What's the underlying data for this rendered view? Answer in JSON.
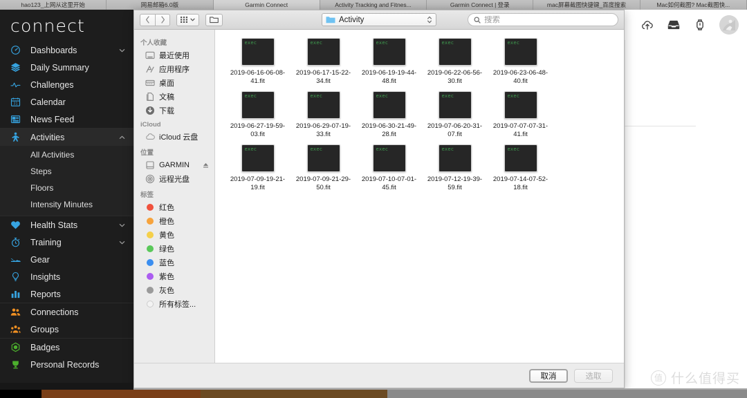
{
  "browser": {
    "tabs": [
      {
        "label": "hao123_上网从这里开始",
        "active": false
      },
      {
        "label": "网易邮箱6.0版",
        "active": false
      },
      {
        "label": "Garmin Connect",
        "active": true
      },
      {
        "label": "Activity Tracking and Fitnes...",
        "active": false
      },
      {
        "label": "Garmin Connect | 登录",
        "active": false
      },
      {
        "label": "mac屏幕截图快捷键_百度搜索",
        "active": false
      },
      {
        "label": "Mac如何截图? Mac截图快...",
        "active": false
      }
    ]
  },
  "garmin": {
    "logo": "connect",
    "header_icons": [
      {
        "name": "cloud-upload-icon"
      },
      {
        "name": "inbox-icon"
      },
      {
        "name": "watch-icon"
      },
      {
        "name": "avatar"
      }
    ],
    "nav_groups": [
      {
        "items": [
          {
            "label": "Dashboards",
            "icon": "gauge-icon",
            "color": "blue",
            "chevron": "down",
            "selected": false
          },
          {
            "label": "Daily Summary",
            "icon": "layers-icon",
            "color": "blue",
            "chevron": "",
            "selected": false
          },
          {
            "label": "Challenges",
            "icon": "pulse-icon",
            "color": "blue",
            "chevron": "",
            "selected": false
          },
          {
            "label": "Calendar",
            "icon": "calendar-icon",
            "color": "blue",
            "chevron": "",
            "selected": false
          },
          {
            "label": "News Feed",
            "icon": "news-icon",
            "color": "blue",
            "chevron": "",
            "selected": false
          }
        ]
      },
      {
        "items": [
          {
            "label": "Activities",
            "icon": "runner-icon",
            "color": "blue",
            "chevron": "up",
            "selected": true
          }
        ],
        "sub_items": [
          {
            "label": "All Activities"
          },
          {
            "label": "Steps"
          },
          {
            "label": "Floors"
          },
          {
            "label": "Intensity Minutes"
          }
        ]
      },
      {
        "items": [
          {
            "label": "Health Stats",
            "icon": "heart-icon",
            "color": "blue",
            "chevron": "down",
            "selected": false
          },
          {
            "label": "Training",
            "icon": "stopwatch-icon",
            "color": "blue",
            "chevron": "down",
            "selected": false
          },
          {
            "label": "Gear",
            "icon": "shoe-icon",
            "color": "blue",
            "chevron": "",
            "selected": false
          },
          {
            "label": "Insights",
            "icon": "bulb-icon",
            "color": "blue",
            "chevron": "",
            "selected": false
          },
          {
            "label": "Reports",
            "icon": "bars-icon",
            "color": "blue",
            "chevron": "",
            "selected": false
          }
        ]
      },
      {
        "items": [
          {
            "label": "Connections",
            "icon": "people-icon",
            "color": "orange",
            "chevron": "",
            "selected": false
          },
          {
            "label": "Groups",
            "icon": "group-icon",
            "color": "orange",
            "chevron": "",
            "selected": false
          }
        ]
      },
      {
        "items": [
          {
            "label": "Badges",
            "icon": "badge-icon",
            "color": "green",
            "chevron": "",
            "selected": false
          },
          {
            "label": "Personal Records",
            "icon": "trophy-icon",
            "color": "green",
            "chevron": "",
            "selected": false
          }
        ]
      }
    ]
  },
  "dialog": {
    "toolbar": {
      "back_icon": "chevron-left-icon",
      "forward_icon": "chevron-right-icon",
      "view_icon": "grid-view-icon",
      "group_icon": "new-folder-icon",
      "path_label": "Activity",
      "search_placeholder": "搜索",
      "search_value": ""
    },
    "sidebar": [
      {
        "heading": "个人收藏",
        "items": [
          {
            "label": "最近使用",
            "icon": "recents-icon"
          },
          {
            "label": "应用程序",
            "icon": "applications-icon"
          },
          {
            "label": "桌面",
            "icon": "desktop-icon"
          },
          {
            "label": "文稿",
            "icon": "documents-icon"
          },
          {
            "label": "下载",
            "icon": "downloads-icon"
          }
        ]
      },
      {
        "heading": "iCloud",
        "items": [
          {
            "label": "iCloud 云盘",
            "icon": "icloud-icon"
          }
        ]
      },
      {
        "heading": "位置",
        "items": [
          {
            "label": "GARMIN",
            "icon": "drive-icon",
            "eject": true
          },
          {
            "label": "远程光盘",
            "icon": "disc-icon"
          }
        ]
      },
      {
        "heading": "标签",
        "items": [
          {
            "label": "红色",
            "icon": "tag-dot",
            "color": "#f0513c"
          },
          {
            "label": "橙色",
            "icon": "tag-dot",
            "color": "#f7a33c"
          },
          {
            "label": "黄色",
            "icon": "tag-dot",
            "color": "#f5d04a"
          },
          {
            "label": "绿色",
            "icon": "tag-dot",
            "color": "#5ac85a"
          },
          {
            "label": "蓝色",
            "icon": "tag-dot",
            "color": "#3b8ef0"
          },
          {
            "label": "紫色",
            "icon": "tag-dot",
            "color": "#ab5cf0"
          },
          {
            "label": "灰色",
            "icon": "tag-dot",
            "color": "#9a9a9a"
          },
          {
            "label": "所有标签...",
            "icon": "tag-dot-outline",
            "color": "#e6e6e6"
          }
        ]
      }
    ],
    "files": [
      {
        "name": "2019-06-16-06-08-41.fit",
        "icon_label": "exec"
      },
      {
        "name": "2019-06-17-15-22-34.fit",
        "icon_label": "exec"
      },
      {
        "name": "2019-06-19-19-44-48.fit",
        "icon_label": "exec"
      },
      {
        "name": "2019-06-22-06-56-30.fit",
        "icon_label": "exec"
      },
      {
        "name": "2019-06-23-06-48-40.fit",
        "icon_label": "exec"
      },
      {
        "name": "2019-06-27-19-59-03.fit",
        "icon_label": "exec"
      },
      {
        "name": "2019-06-29-07-19-33.fit",
        "icon_label": "exec"
      },
      {
        "name": "2019-06-30-21-49-28.fit",
        "icon_label": "exec"
      },
      {
        "name": "2019-07-06-20-31-07.fit",
        "icon_label": "exec"
      },
      {
        "name": "2019-07-07-07-31-41.fit",
        "icon_label": "exec"
      },
      {
        "name": "2019-07-09-19-21-19.fit",
        "icon_label": "exec"
      },
      {
        "name": "2019-07-09-21-29-50.fit",
        "icon_label": "exec"
      },
      {
        "name": "2019-07-10-07-01-45.fit",
        "icon_label": "exec"
      },
      {
        "name": "2019-07-12-19-39-59.fit",
        "icon_label": "exec"
      },
      {
        "name": "2019-07-14-07-52-18.fit",
        "icon_label": "exec"
      }
    ],
    "footer": {
      "cancel_label": "取消",
      "choose_label": "选取"
    }
  },
  "watermark": {
    "mark": "值",
    "text": "什么值得买"
  }
}
